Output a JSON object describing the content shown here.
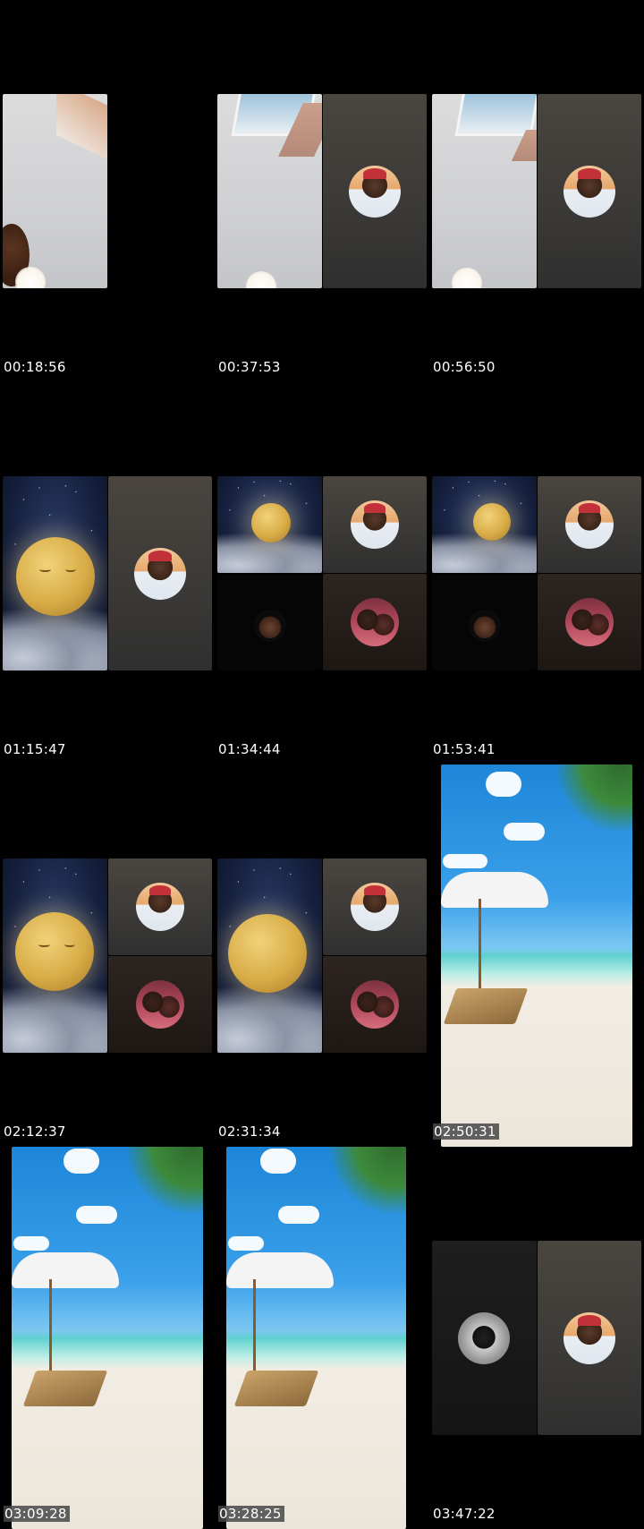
{
  "frames": [
    {
      "timestamp": "00:18:56"
    },
    {
      "timestamp": "00:37:53"
    },
    {
      "timestamp": "00:56:50"
    },
    {
      "timestamp": "01:15:47"
    },
    {
      "timestamp": "01:34:44"
    },
    {
      "timestamp": "01:53:41"
    },
    {
      "timestamp": "02:12:37"
    },
    {
      "timestamp": "02:31:34"
    },
    {
      "timestamp": "02:50:31"
    },
    {
      "timestamp": "03:09:28"
    },
    {
      "timestamp": "03:28:25"
    },
    {
      "timestamp": "03:47:22"
    }
  ]
}
